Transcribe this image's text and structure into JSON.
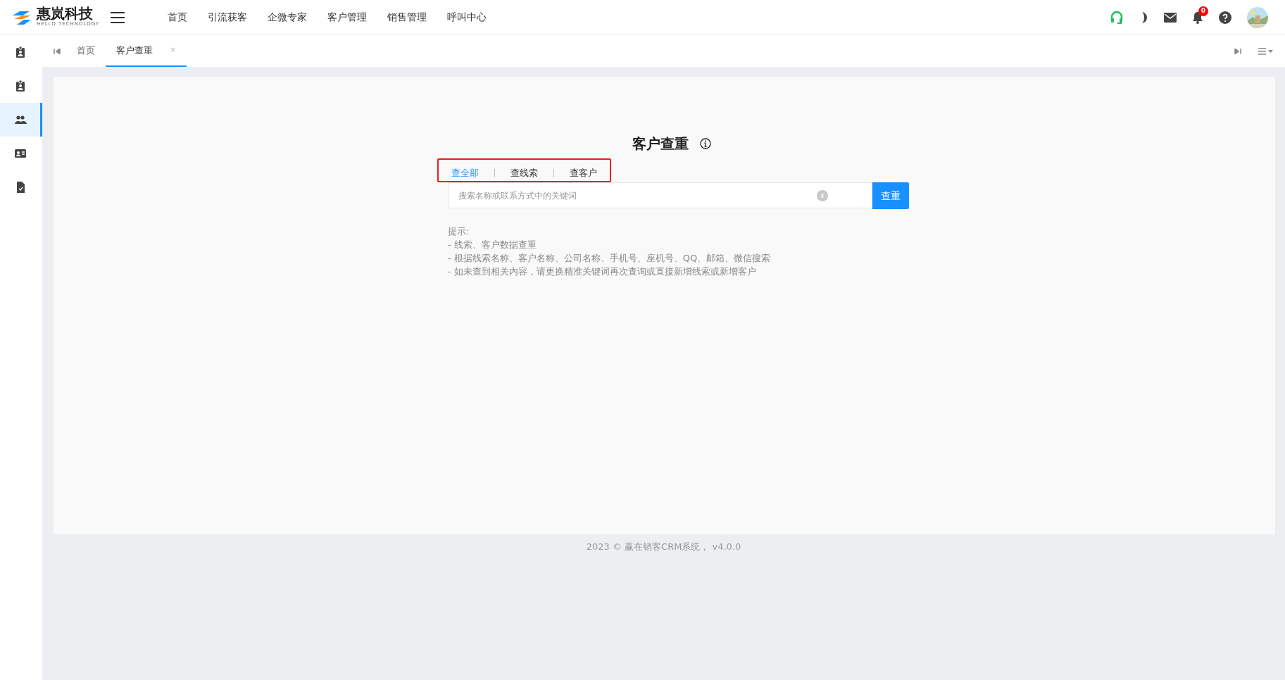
{
  "header": {
    "logo_text": "惠岚科技",
    "logo_subtext": "HELLO TECHNOLOGY",
    "nav": [
      {
        "label": "首页"
      },
      {
        "label": "引流获客"
      },
      {
        "label": "企微专家"
      },
      {
        "label": "客户管理"
      },
      {
        "label": "销售管理"
      },
      {
        "label": "呼叫中心"
      }
    ],
    "notification_count": "0"
  },
  "sidebar": {
    "items": [
      {
        "kind": "badge",
        "selected": false
      },
      {
        "kind": "badge",
        "selected": false
      },
      {
        "kind": "people",
        "selected": true
      },
      {
        "kind": "card",
        "selected": false
      },
      {
        "kind": "document",
        "selected": false
      }
    ]
  },
  "page_tabs": [
    {
      "label": "首页",
      "selected": false,
      "closable": false
    },
    {
      "label": "客户查重",
      "selected": true,
      "closable": true
    }
  ],
  "page_tabs_close": "×",
  "main": {
    "title": "客户查重",
    "search_types": [
      {
        "label": "查全部",
        "selected": true
      },
      {
        "label": "查线索",
        "selected": false
      },
      {
        "label": "查客户",
        "selected": false
      }
    ],
    "search": {
      "placeholder": "搜索名称或联系方式中的关键词"
    },
    "clear_label": "x",
    "search_button": "查重",
    "hints": [
      "提示:",
      "- 线索、客户数据查重",
      "- 根据线索名称、客户名称、公司名称、手机号、座机号、QQ、邮箱、微信搜索",
      "- 如未查到相关内容，请更换精准关键词再次查询或直接新增线索或新增客户"
    ]
  },
  "footer": "2023 © 赢在销客CRM系统， v4.0.0"
}
